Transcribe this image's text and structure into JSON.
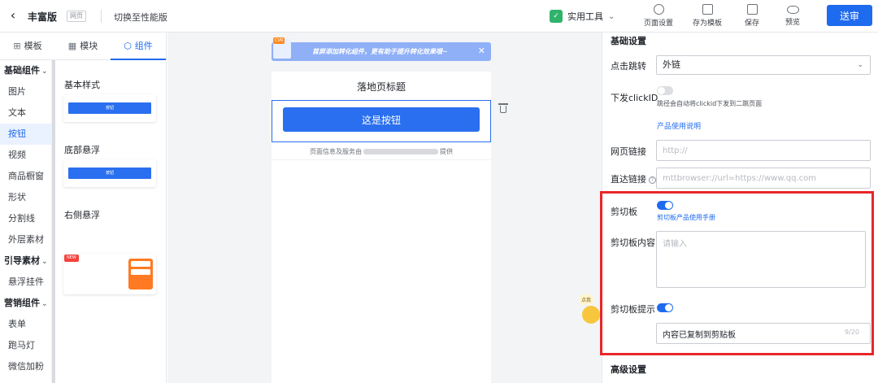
{
  "topbar": {
    "back_icon": "chevron-left-icon",
    "app_title": "丰富版",
    "page_tag": "网页",
    "switch_label": "切换至性能版",
    "tools_label": "实用工具",
    "tools_icon": "shield-icon",
    "actions": {
      "page_settings": "页面设置",
      "save_template": "存为模板",
      "save": "保存",
      "preview": "预览"
    },
    "submit_label": "送审",
    "accent_color": "#1f6bef"
  },
  "left": {
    "tabs": [
      {
        "label": "模板",
        "icon": "template-icon"
      },
      {
        "label": "模块",
        "icon": "grid-icon"
      },
      {
        "label": "组件",
        "icon": "cube-icon",
        "active": true
      }
    ],
    "categories": [
      {
        "label": "基础组件",
        "group": true
      },
      {
        "label": "图片"
      },
      {
        "label": "文本"
      },
      {
        "label": "按钮",
        "active": true
      },
      {
        "label": "视频"
      },
      {
        "label": "商品橱窗"
      },
      {
        "label": "形状"
      },
      {
        "label": "分割线"
      },
      {
        "label": "外层素材"
      },
      {
        "label": "引导素材",
        "group": true
      },
      {
        "label": "悬浮挂件"
      },
      {
        "label": "营销组件",
        "group": true
      },
      {
        "label": "表单"
      },
      {
        "label": "跑马灯"
      },
      {
        "label": "微信加粉"
      }
    ],
    "styles": {
      "basic_title": "基本样式",
      "bottom_title": "底部悬浮",
      "right_title": "右侧悬浮",
      "button_thumb_label": "按钮",
      "new_tag": "NEW"
    }
  },
  "canvas": {
    "notice_badge": "CVR",
    "notice_text": "首屏添加转化组件，更有助于提升转化效果哦~",
    "page_title": "落地页标题",
    "cta_label": "这是按钮",
    "footer_prefix": "页面信息及服务由",
    "footer_suffix": "提供",
    "mascot_bubble": "点我"
  },
  "right": {
    "basic_section": "基础设置",
    "click_jump_label": "点击跳转",
    "click_jump_value": "外链",
    "clickid_label": "下发clickID",
    "clickid_hint": "跳径会自动将clickid下发到二跳页面",
    "product_doc_link": "产品使用说明",
    "web_link_label": "网页链接",
    "web_link_placeholder": "http://",
    "direct_link_label": "直达链接",
    "direct_link_placeholder": "mttbrowser://url=https://www.qq.com",
    "clipboard_label": "剪切板",
    "clipboard_manual_link": "剪切板产品使用手册",
    "clipboard_content_label": "剪切板内容",
    "clipboard_content_placeholder": "请输入",
    "clipboard_tip_label": "剪切板提示",
    "clipboard_tip_value": "内容已复制到剪贴板",
    "clipboard_tip_counter": "9/20",
    "advanced_section": "高级设置",
    "highlight_color": "#e8262a"
  }
}
